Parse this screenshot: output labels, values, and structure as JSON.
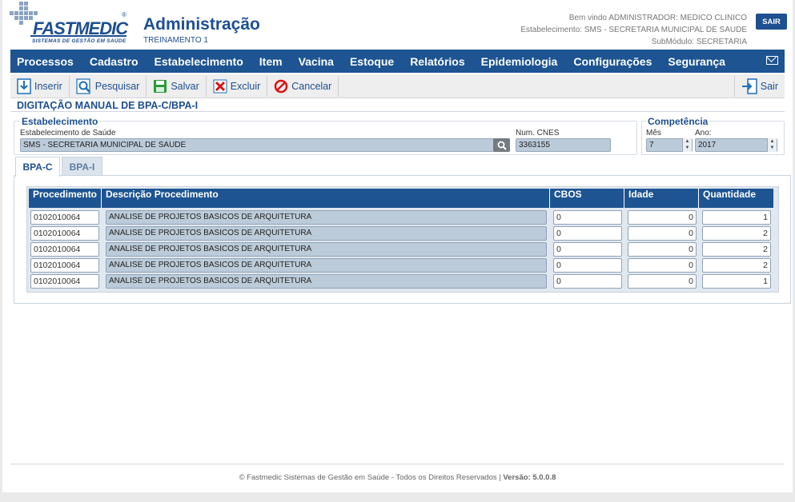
{
  "header": {
    "logo_text": "FASTMEDIC",
    "logo_reg": "®",
    "logo_sub": "SISTEMAS DE GESTÃO EM SAÚDE",
    "title": "Administração",
    "subtitle": "TREINAMENTO 1",
    "welcome": "Bem vindo ADMINISTRADOR: MEDICO CLINICO",
    "establishment": "Estabelecimento: SMS - SECRETARIA MUNICIPAL DE SAUDE",
    "submodule": "SubMódulo: SECRETARIA",
    "logout_label": "SAIR"
  },
  "menu": {
    "items": [
      "Processos",
      "Cadastro",
      "Estabelecimento",
      "Item",
      "Vacina",
      "Estoque",
      "Relatórios",
      "Epidemiologia",
      "Configurações",
      "Segurança"
    ]
  },
  "toolbar": {
    "insert_label": "Inserir",
    "search_label": "Pesquisar",
    "save_label": "Salvar",
    "delete_label": "Excluir",
    "cancel_label": "Cancelar",
    "exit_label": "Sair"
  },
  "form": {
    "section_title": "DIGITAÇÃO MANUAL DE BPA-C/BPA-I",
    "estab_legend": "Estabelecimento",
    "estab_label": "Estabelecimento de Saúde",
    "estab_value": "SMS - SECRETARIA MUNICIPAL DE SAUDE",
    "cnes_label": "Num. CNES",
    "cnes_value": "3363155",
    "comp_legend": "Competência",
    "month_label": "Mês",
    "month_value": "7",
    "year_label": "Ano:",
    "year_value": "2017"
  },
  "tabs": [
    {
      "label": "BPA-C",
      "active": true
    },
    {
      "label": "BPA-I",
      "active": false
    }
  ],
  "table": {
    "headers": [
      "Procedimento",
      "Descrição Procedimento",
      "CBOS",
      "Idade",
      "Quantidade"
    ],
    "rows": [
      {
        "procedimento": "0102010064",
        "descricao": "ANALISE DE PROJETOS BASICOS DE ARQUITETURA",
        "cbos": "0",
        "idade": "0",
        "quantidade": "1"
      },
      {
        "procedimento": "0102010064",
        "descricao": "ANALISE DE PROJETOS BASICOS DE ARQUITETURA",
        "cbos": "0",
        "idade": "0",
        "quantidade": "2"
      },
      {
        "procedimento": "0102010064",
        "descricao": "ANALISE DE PROJETOS BASICOS DE ARQUITETURA",
        "cbos": "0",
        "idade": "0",
        "quantidade": "2"
      },
      {
        "procedimento": "0102010064",
        "descricao": "ANALISE DE PROJETOS BASICOS DE ARQUITETURA",
        "cbos": "0",
        "idade": "0",
        "quantidade": "2"
      },
      {
        "procedimento": "0102010064",
        "descricao": "ANALISE DE PROJETOS BASICOS DE ARQUITETURA",
        "cbos": "0",
        "idade": "0",
        "quantidade": "1"
      }
    ]
  },
  "footer": {
    "copyright": "© Fastmedic Sistemas de Gestão em Saúde - Todos os Direitos Reservados |",
    "version": "Versão: 5.0.0.8"
  },
  "colors": {
    "brand": "#1d4f91",
    "menu_bg": "#1d5491",
    "readonly_bg": "#bccbd9"
  }
}
